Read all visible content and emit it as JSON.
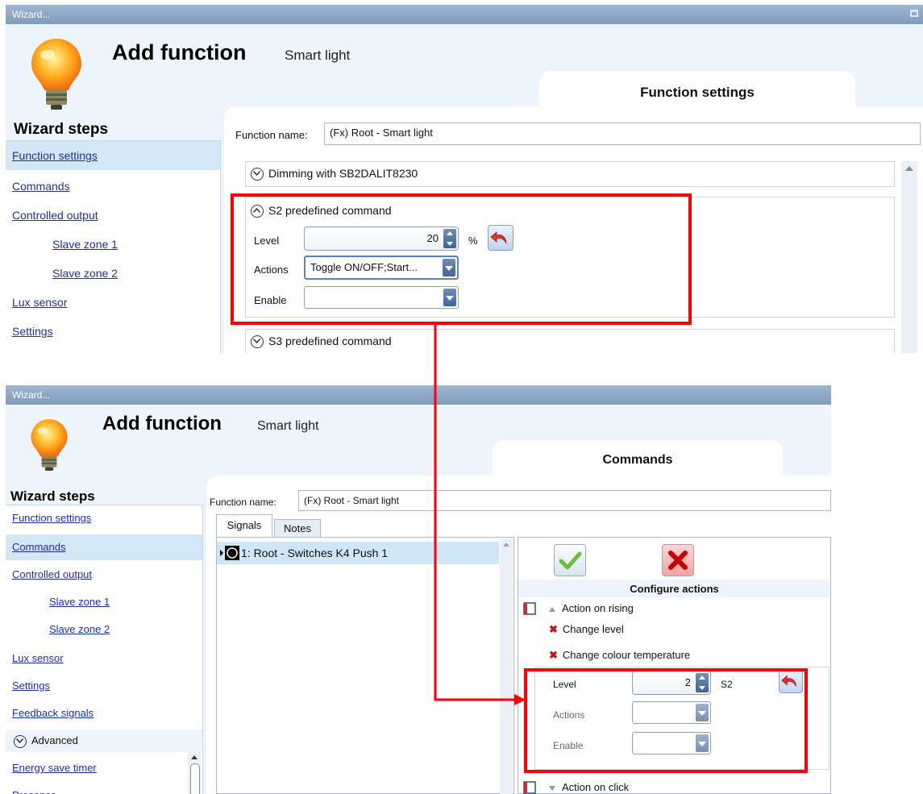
{
  "top": {
    "window_title": "Wizard...",
    "header_title": "Add function",
    "header_subtitle": "Smart light",
    "tab_title": "Function settings",
    "wizard_steps_title": "Wizard steps",
    "steps": [
      {
        "label": "Function settings",
        "selected": true
      },
      {
        "label": "Commands"
      },
      {
        "label": "Controlled output"
      },
      {
        "label": "Slave zone 1"
      },
      {
        "label": "Slave zone 2"
      },
      {
        "label": "Lux sensor"
      },
      {
        "label": "Settings"
      }
    ],
    "function_name_label": "Function name:",
    "function_name_value": "(Fx) Root - Smart light",
    "group_dimming": "Dimming with SB2DALIT8230",
    "group_s2": "S2 predefined command",
    "level_label": "Level",
    "level_value": "20",
    "level_unit": "%",
    "actions_label": "Actions",
    "actions_value": "Toggle ON/OFF;Start...",
    "enable_label": "Enable",
    "enable_value": "",
    "group_s3": "S3 predefined command"
  },
  "bottom": {
    "window_title": "Wizard...",
    "header_title": "Add function",
    "header_subtitle": "Smart light",
    "tab_title": "Commands",
    "wizard_steps_title": "Wizard steps",
    "steps": [
      {
        "label": "Function settings"
      },
      {
        "label": "Commands",
        "selected": true
      },
      {
        "label": "Controlled output"
      },
      {
        "label": "Slave zone 1"
      },
      {
        "label": "Slave zone 2"
      },
      {
        "label": "Lux sensor"
      },
      {
        "label": "Settings"
      },
      {
        "label": "Feedback signals"
      }
    ],
    "advanced_label": "Advanced",
    "advanced_steps": [
      "Energy save timer",
      "Presence"
    ],
    "function_name_label": "Function name:",
    "function_name_value": "(Fx) Root - Smart light",
    "tabs": [
      "Signals",
      "Notes"
    ],
    "signal_row": "1: Root - Switches K4 Push 1",
    "configure_actions": "Configure actions",
    "action_on_rising": "Action on rising",
    "change_level": "Change level",
    "change_colour_temperature": "Change colour temperature",
    "level_label": "Level",
    "level_value": "2",
    "level_ref": "S2",
    "actions_label": "Actions",
    "enable_label": "Enable",
    "action_on_click": "Action on click"
  },
  "colors": {
    "title_bar": "#8aa4c4",
    "window_bg": "#eef4fb",
    "link": "#1a2fb0",
    "selected_row": "#d4e7f6",
    "highlight": "#ff0000"
  }
}
